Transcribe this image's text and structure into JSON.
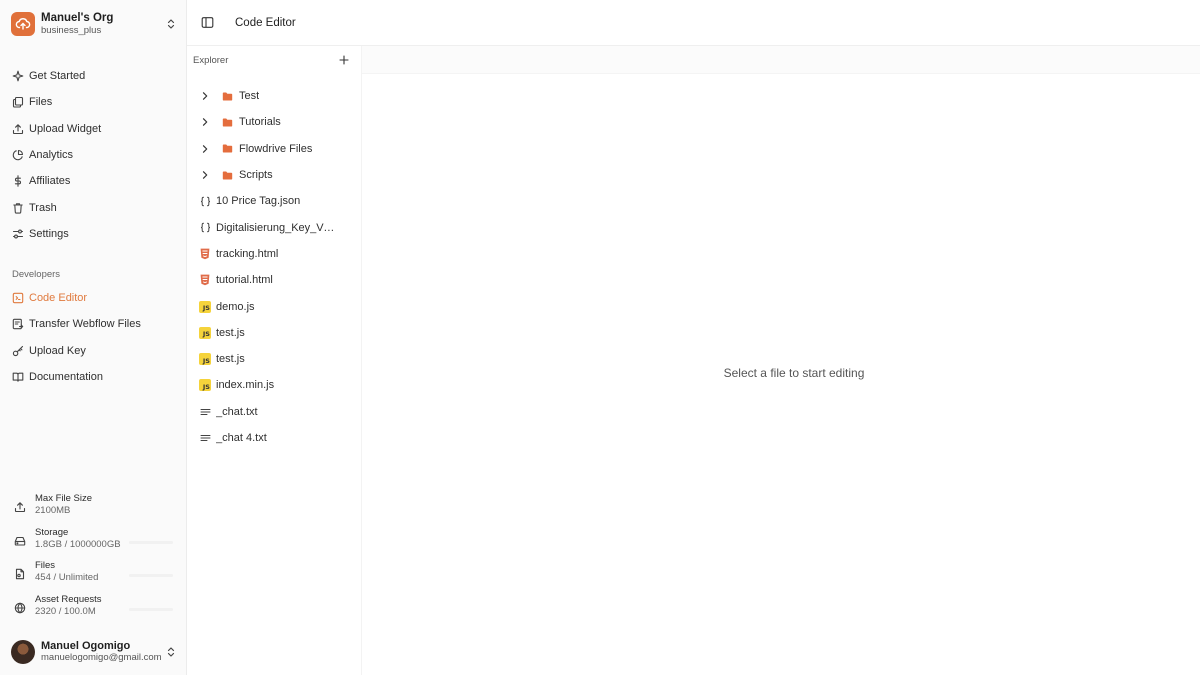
{
  "org": {
    "name": "Manuel's Org",
    "plan": "business_plus"
  },
  "nav": {
    "main": [
      {
        "label": "Get Started",
        "icon": "sparkle-icon"
      },
      {
        "label": "Files",
        "icon": "files-icon"
      },
      {
        "label": "Upload Widget",
        "icon": "upload-icon"
      },
      {
        "label": "Analytics",
        "icon": "pie-chart-icon"
      },
      {
        "label": "Affiliates",
        "icon": "dollar-icon"
      },
      {
        "label": "Trash",
        "icon": "trash-icon"
      },
      {
        "label": "Settings",
        "icon": "sliders-icon"
      }
    ],
    "developers_label": "Developers",
    "developers": [
      {
        "label": "Code Editor",
        "icon": "code-icon",
        "active": true
      },
      {
        "label": "Transfer Webflow Files",
        "icon": "transfer-icon"
      },
      {
        "label": "Upload Key",
        "icon": "key-icon"
      },
      {
        "label": "Documentation",
        "icon": "book-icon"
      }
    ]
  },
  "stats": [
    {
      "label": "Max File Size",
      "value": "2100MB",
      "icon": "upload-icon"
    },
    {
      "label": "Storage",
      "value": "1.8GB / 1000000GB",
      "icon": "hard-drive-icon"
    },
    {
      "label": "Files",
      "value": "454 / Unlimited",
      "icon": "file-icon"
    },
    {
      "label": "Asset Requests",
      "value": "2320 / 100.0M",
      "icon": "globe-icon"
    }
  ],
  "user": {
    "name": "Manuel Ogomigo",
    "email": "manuelogomigo@gmail.com"
  },
  "header": {
    "title": "Code Editor"
  },
  "explorer": {
    "title": "Explorer",
    "folders": [
      "Test",
      "Tutorials",
      "Flowdrive Files",
      "Scripts"
    ],
    "files": [
      {
        "name": "10 Price Tag.json",
        "type": "json"
      },
      {
        "name": "Digitalisierung_Key_Visual.json",
        "type": "json"
      },
      {
        "name": "tracking.html",
        "type": "html"
      },
      {
        "name": "tutorial.html",
        "type": "html"
      },
      {
        "name": "demo.js",
        "type": "js"
      },
      {
        "name": "test.js",
        "type": "js"
      },
      {
        "name": "test.js",
        "type": "js"
      },
      {
        "name": "index.min.js",
        "type": "js"
      },
      {
        "name": "_chat.txt",
        "type": "txt"
      },
      {
        "name": "_chat 4.txt",
        "type": "txt"
      }
    ]
  },
  "editor": {
    "empty_message": "Select a file to start editing"
  },
  "colors": {
    "accent": "#e0703a",
    "active_text": "#e07a3e",
    "js_badge": "#f5d33b",
    "html_icon": "#e06c4a"
  }
}
